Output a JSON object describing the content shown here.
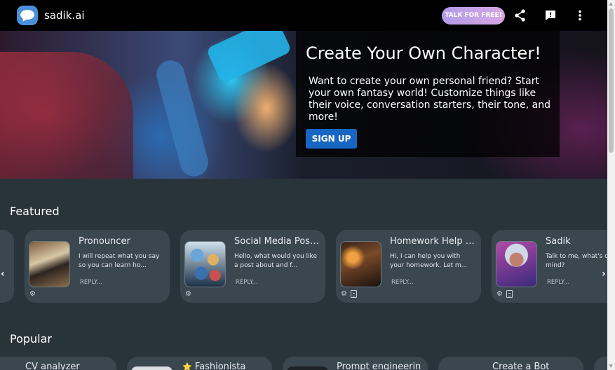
{
  "app": {
    "name": "sadik.ai"
  },
  "topbar": {
    "talk_label": "TALK FOR FREE!",
    "icons": [
      "share-icon",
      "feedback-icon",
      "more-vert-icon"
    ]
  },
  "hero": {
    "title": "Create Your Own Character!",
    "description": "Want to create your own personal friend? Start your own fantasy world! Customize things like their voice, conversation starters, their tone, and more!",
    "signup_label": "SIGN UP"
  },
  "featured": {
    "title": "Featured",
    "cards": [
      {
        "name": "Pronouncer",
        "description": "I will repeat what you say so you can learn ho...",
        "reply": "REPLY...",
        "badges": [
          "settings-icon"
        ]
      },
      {
        "name": "Social Media Post ...",
        "description": "Hello, what would you like a post about and f...",
        "reply": "REPLY...",
        "badges": [
          "settings-icon"
        ]
      },
      {
        "name": "Homework Help AI...",
        "description": "Hi, I can help you with your homework. Let m...",
        "reply": "REPLY...",
        "badges": [
          "settings-icon",
          "document-icon"
        ]
      },
      {
        "name": "Sadik",
        "description": "Talk to me, what's on your mind?",
        "reply": "REPLY...",
        "badges": [
          "settings-icon",
          "document-icon"
        ]
      }
    ]
  },
  "popular": {
    "title": "Popular",
    "cards": [
      {
        "name": "CV analyzer"
      },
      {
        "name": "Fashionista",
        "star": "⭐"
      },
      {
        "name": "Prompt engineerin"
      },
      {
        "name": "Create a Bot"
      }
    ]
  },
  "colors": {
    "background": "#29343a",
    "card": "#3a474f",
    "topbar": "#000000",
    "signup": "#1866c4",
    "talk_gradient_start": "#b39ce8",
    "talk_gradient_end": "#d7a6e4"
  }
}
